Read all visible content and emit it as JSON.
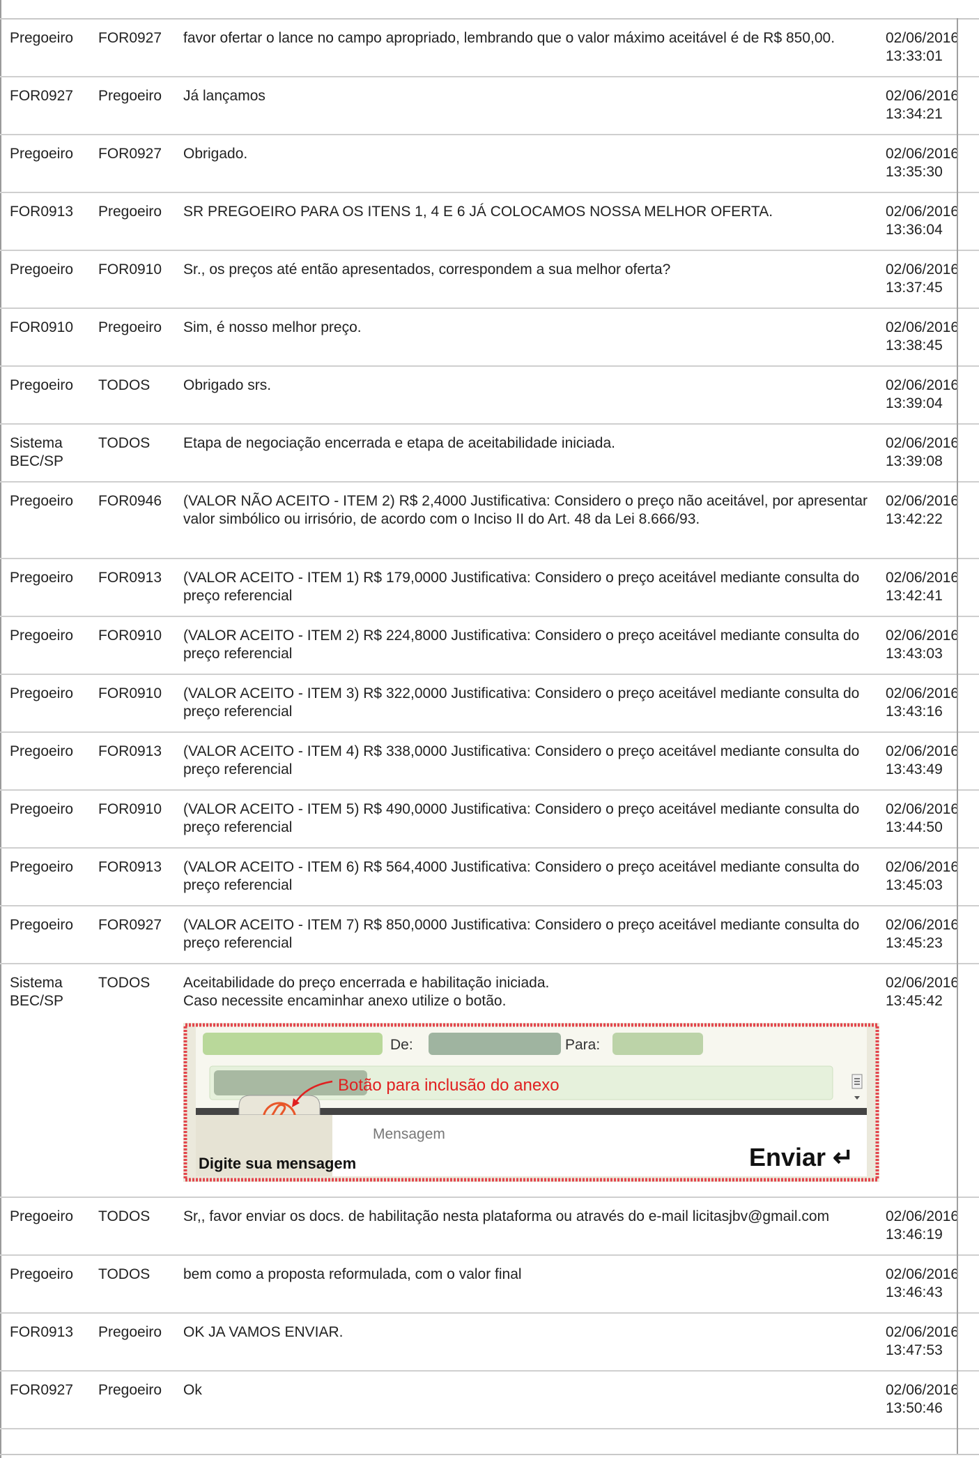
{
  "messages": [
    {
      "from": "Pregoeiro",
      "to": "FOR0927",
      "text": "favor ofertar o lance no campo apropriado, lembrando que o valor máximo aceitável é de R$ 850,00.",
      "date": "02/06/2016",
      "time": "13:33:01"
    },
    {
      "from": "FOR0927",
      "to": "Pregoeiro",
      "text": "Já lançamos",
      "date": "02/06/2016",
      "time": "13:34:21"
    },
    {
      "from": "Pregoeiro",
      "to": "FOR0927",
      "text": "Obrigado.",
      "date": "02/06/2016",
      "time": "13:35:30"
    },
    {
      "from": "FOR0913",
      "to": "Pregoeiro",
      "text": "SR PREGOEIRO PARA OS ITENS 1, 4 E 6 JÁ COLOCAMOS NOSSA MELHOR OFERTA.",
      "date": "02/06/2016",
      "time": "13:36:04"
    },
    {
      "from": "Pregoeiro",
      "to": "FOR0910",
      "text": "Sr., os preços até então apresentados, correspondem a sua melhor oferta?",
      "date": "02/06/2016",
      "time": "13:37:45"
    },
    {
      "from": "FOR0910",
      "to": "Pregoeiro",
      "text": "Sim, é nosso melhor preço.",
      "date": "02/06/2016",
      "time": "13:38:45"
    },
    {
      "from": "Pregoeiro",
      "to": "TODOS",
      "text": "Obrigado srs.",
      "date": "02/06/2016",
      "time": "13:39:04"
    },
    {
      "from": "Sistema BEC/SP",
      "to": "TODOS",
      "text": "Etapa de negociação encerrada e etapa de aceitabilidade iniciada.",
      "date": "02/06/2016",
      "time": "13:39:08"
    },
    {
      "from": "Pregoeiro",
      "to": "FOR0946",
      "text": "(VALOR NÃO ACEITO - ITEM 2) R$ 2,4000 Justificativa: Considero o preço não aceitável, por apresentar valor simbólico ou irrisório, de acordo com o Inciso II do Art. 48 da Lei 8.666/93.",
      "date": "02/06/2016",
      "time": "13:42:22"
    },
    {
      "from": "Pregoeiro",
      "to": "FOR0913",
      "text": "(VALOR ACEITO - ITEM 1) R$ 179,0000 Justificativa: Considero o preço aceitável mediante consulta do preço referencial",
      "date": "02/06/2016",
      "time": "13:42:41"
    },
    {
      "from": "Pregoeiro",
      "to": "FOR0910",
      "text": "(VALOR ACEITO - ITEM 2) R$ 224,8000 Justificativa: Considero o preço aceitável mediante consulta do preço referencial",
      "date": "02/06/2016",
      "time": "13:43:03"
    },
    {
      "from": "Pregoeiro",
      "to": "FOR0910",
      "text": "(VALOR ACEITO - ITEM 3) R$ 322,0000 Justificativa: Considero o preço aceitável mediante consulta do preço referencial",
      "date": "02/06/2016",
      "time": "13:43:16"
    },
    {
      "from": "Pregoeiro",
      "to": "FOR0913",
      "text": "(VALOR ACEITO - ITEM 4) R$ 338,0000 Justificativa: Considero o preço aceitável mediante consulta do preço referencial",
      "date": "02/06/2016",
      "time": "13:43:49"
    },
    {
      "from": "Pregoeiro",
      "to": "FOR0910",
      "text": "(VALOR ACEITO - ITEM 5) R$ 490,0000 Justificativa: Considero o preço aceitável mediante consulta do preço referencial",
      "date": "02/06/2016",
      "time": "13:44:50"
    },
    {
      "from": "Pregoeiro",
      "to": "FOR0913",
      "text": "(VALOR ACEITO - ITEM 6) R$ 564,4000 Justificativa: Considero o preço aceitável mediante consulta do preço referencial",
      "date": "02/06/2016",
      "time": "13:45:03"
    },
    {
      "from": "Pregoeiro",
      "to": "FOR0927",
      "text": "(VALOR ACEITO - ITEM 7) R$ 850,0000 Justificativa: Considero o preço aceitável mediante consulta do preço referencial",
      "date": "02/06/2016",
      "time": "13:45:23"
    },
    {
      "from": "Sistema BEC/SP",
      "to": "TODOS",
      "text": "Aceitabilidade do preço encerrada e habilitação iniciada.\nCaso necessite encaminhar anexo utilize o botão.",
      "date": "02/06/2016",
      "time": "13:45:42",
      "attachment": {
        "de_label": "De:",
        "para_label": "Para:",
        "annotation": "Botão para inclusão do anexo",
        "tab_label": "Digite sua mensagem",
        "input_placeholder": "Mensagem",
        "send_label": "Enviar ↵"
      }
    },
    {
      "from": "Pregoeiro",
      "to": "TODOS",
      "text": "Sr,, favor enviar os docs. de habilitação nesta plataforma ou através do e-mail licitasjbv@gmail.com",
      "date": "02/06/2016",
      "time": "13:46:19"
    },
    {
      "from": "Pregoeiro",
      "to": "TODOS",
      "text": "bem como a proposta reformulada, com o valor final",
      "date": "02/06/2016",
      "time": "13:46:43"
    },
    {
      "from": "FOR0913",
      "to": "Pregoeiro",
      "text": "OK JA VAMOS ENVIAR.",
      "date": "02/06/2016",
      "time": "13:47:53"
    },
    {
      "from": "FOR0927",
      "to": "Pregoeiro",
      "text": "Ok",
      "date": "02/06/2016",
      "time": "13:50:46"
    }
  ]
}
